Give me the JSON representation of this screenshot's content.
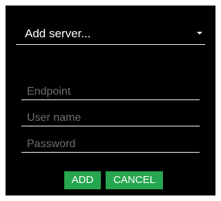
{
  "server_select": {
    "selected_label": "Add server...",
    "chevron_icon": "chevron-down-icon"
  },
  "fields": {
    "endpoint": {
      "value": "",
      "placeholder": "Endpoint"
    },
    "username": {
      "value": "",
      "placeholder": "User name"
    },
    "password": {
      "value": "",
      "placeholder": "Password"
    }
  },
  "actions": {
    "add_label": "ADD",
    "cancel_label": "CANCEL"
  },
  "colors": {
    "background": "#000000",
    "accent": "#27a650",
    "text": "#ffffff",
    "placeholder": "#6f6f6f"
  }
}
